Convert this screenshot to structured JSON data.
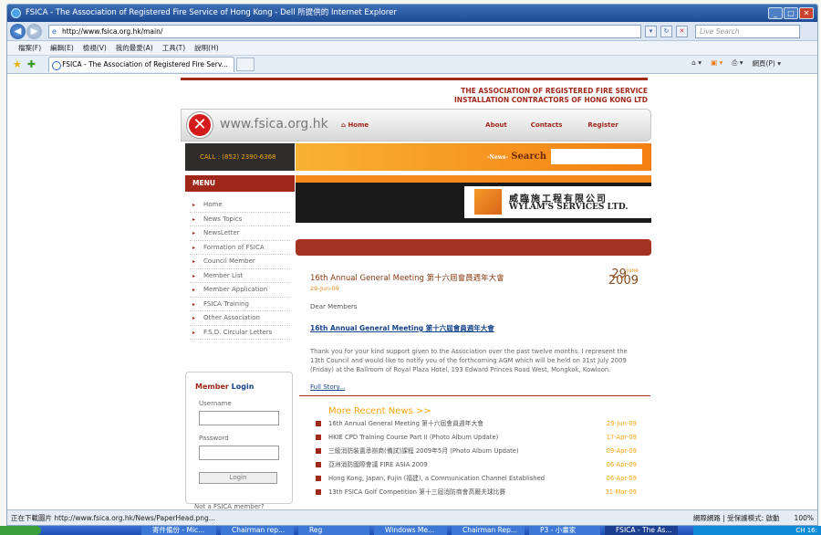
{
  "window": {
    "title": "FSICA - The Association of Registered Fire Service of Hong Kong - Dell 所提供的 Internet Explorer",
    "url": "http://www.fsica.org.hk/main/",
    "live_search_placeholder": "Live Search"
  },
  "menubar": [
    "檔案(F)",
    "編輯(E)",
    "檢視(V)",
    "我的最愛(A)",
    "工具(T)",
    "說明(H)"
  ],
  "tab": {
    "label": "FSICA - The Association of Registered Fire Serv..."
  },
  "toolbar": {
    "page_label": "網頁(P) ▾"
  },
  "site": {
    "assoc_line1": "THE ASSOCIATION OF REGISTERED FIRE SERVICE",
    "assoc_line2": "INSTALLATION CONTRACTORS OF HONG KONG LTD",
    "logo_text": "www.fsica.org.hk",
    "nav": {
      "home": "Home",
      "about": "About",
      "contacts": "Contacts",
      "register": "Register"
    },
    "call": "CALL : (852) 2390-6368",
    "search_label_small": "-News-",
    "search_label": "Search",
    "menu_title": "MENU",
    "menu": [
      "Home",
      "News Topics",
      "NewsLetter",
      "Formation of FSICA",
      "Council Member",
      "Member List",
      "Member Application",
      "FSICA Training",
      "Other Association",
      "F.S.D. Circular Letters"
    ],
    "banner_cn": "威臨施工程有限公司",
    "banner_en": "WYLAM'S SERVICES LTD.",
    "article": {
      "title": "16th Annual General Meeting 第十六屆會員週年大會",
      "date": "29-Jun-09",
      "day": "29",
      "month": "June",
      "year": "2009",
      "greeting": "Dear Members",
      "link": "16th Annual General Meeting 第十六屆會員週年大會",
      "body": "Thank you for your kind support given to the Association over the past twelve months. I represent the 13th Council and would like to notify you of the forthcoming AGM which will be held on 31st July 2009 (Friday) at the Ballroom of Royal Plaza Hotel, 193 Edward Princes Road West, Mongkok, Kowloon.",
      "full_story": "Full Story..."
    },
    "more_news_title": "More Recent News >>",
    "news": [
      {
        "title": "16th Annual General Meeting 第十六屆會員週年大會",
        "date": "29-Jun-09"
      },
      {
        "title": "HKIE CPD Training Course Part II (Photo Album Update)",
        "date": "17-Apr-09"
      },
      {
        "title": "三級消防裝置承辦商(備試)課程 2009年5月 (Photo Album Update)",
        "date": "09-Apr-09"
      },
      {
        "title": "亞洲消防國際會議 FIRE ASIA 2009",
        "date": "06-Apr-09"
      },
      {
        "title": "Hong Kong, Japan, Fujin (福建), a Communication Channel Established",
        "date": "06-Apr-09"
      },
      {
        "title": "13th FSICA Golf Competition 第十三屆消防商會高爾夫球比賽",
        "date": "31-Mar-09"
      }
    ],
    "login": {
      "title_member": "Member",
      "title_login": "Login",
      "username_label": "Username",
      "password_label": "Password",
      "button": "Login",
      "not_member": "Not a FSICA member?"
    }
  },
  "status": {
    "text": "正在下載圖片 http://www.fsica.org.hk/News/PaperHead.png...",
    "zone": "網際網路 | 受保護模式: 啟動",
    "zoom": "100%"
  },
  "taskbar": [
    "寄件備份 - Mic...",
    "Chairman rep...",
    "Reg",
    "Windows Me...",
    "Chairman Rep...",
    "P3 - 小畫家",
    "FSICA - The As..."
  ],
  "tray_text": "CH  16:"
}
